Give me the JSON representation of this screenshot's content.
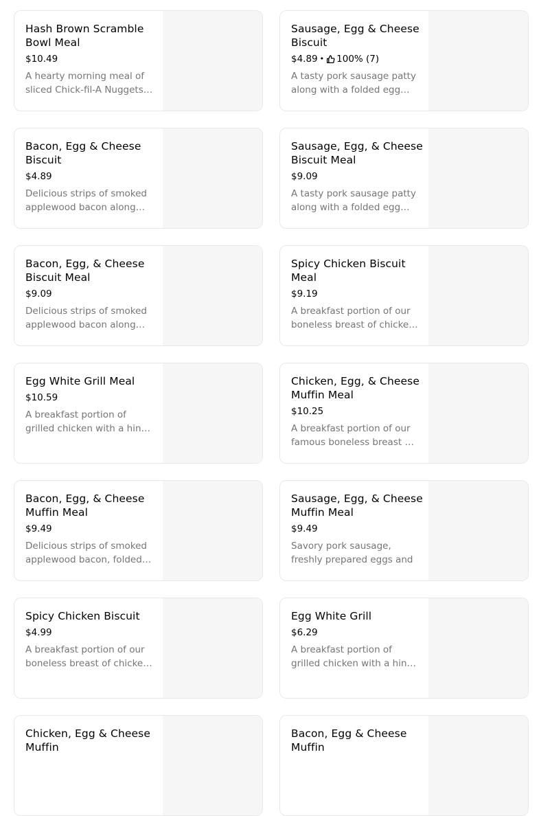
{
  "menu": {
    "items": [
      {
        "name": "Hash Brown Scramble Bowl Meal",
        "price": "$10.49",
        "rating": null,
        "description": "A hearty morning meal of sliced Chick-fil-A Nuggets, scrambled eggs, hash browns, and a blend of cheeses."
      },
      {
        "name": "Sausage, Egg & Cheese Biscuit",
        "price": "$4.89",
        "rating": "100% (7)",
        "description": "A tasty pork sausage patty along with a folded egg and American cheese on a buttermilk biscuit."
      },
      {
        "name": "Bacon, Egg & Cheese Biscuit",
        "price": "$4.89",
        "rating": null,
        "description": "Delicious strips of smoked applewood bacon along with a folded egg and American cheese on a buttermilk biscuit."
      },
      {
        "name": "Sausage, Egg, & Cheese Biscuit Meal",
        "price": "$9.09",
        "rating": null,
        "description": "A tasty pork sausage patty along with a folded egg and American cheese on a buttermilk biscuit."
      },
      {
        "name": "Bacon, Egg, & Cheese Biscuit Meal",
        "price": "$9.09",
        "rating": null,
        "description": "Delicious strips of smoked applewood bacon along with a folded egg and American cheese on a buttermilk biscuit."
      },
      {
        "name": "Spicy Chicken Biscuit Meal",
        "price": "$9.19",
        "rating": null,
        "description": "A breakfast portion of our boneless breast of chicken, seasoned with a spicy blend of peppers."
      },
      {
        "name": "Egg White Grill Meal",
        "price": "$10.59",
        "rating": null,
        "description": "A breakfast portion of grilled chicken with a hint of citrus, served on a toasted English muffin."
      },
      {
        "name": "Chicken, Egg, & Cheese Muffin Meal",
        "price": "$10.25",
        "rating": null,
        "description": "A breakfast portion of our famous boneless breast of chicken with a folded egg and American cheese."
      },
      {
        "name": "Bacon, Egg, & Cheese Muffin Meal",
        "price": "$9.49",
        "rating": null,
        "description": "Delicious strips of smoked applewood bacon, folded egg and American cheese on a toasted English muffin."
      },
      {
        "name": "Sausage, Egg, & Cheese Muffin Meal",
        "price": "$9.49",
        "rating": null,
        "description": "Savory pork sausage, freshly prepared eggs and"
      },
      {
        "name": "Spicy Chicken Biscuit",
        "price": "$4.99",
        "rating": null,
        "description": "A breakfast portion of our boneless breast of chicken, seasoned with a spicy blend of peppers."
      },
      {
        "name": "Egg White Grill",
        "price": "$6.29",
        "rating": null,
        "description": "A breakfast portion of grilled chicken with a hint of citrus, served on a toasted English muffin."
      },
      {
        "name": "Chicken, Egg & Cheese Muffin",
        "price": "",
        "rating": null,
        "description": ""
      },
      {
        "name": "Bacon, Egg & Cheese Muffin",
        "price": "",
        "rating": null,
        "description": ""
      }
    ]
  },
  "icons": {
    "rating": "thumbs-up-icon"
  },
  "colors": {
    "card_border": "#e8e8e8",
    "image_placeholder": "#f6f6f6",
    "description_text": "#757575"
  }
}
